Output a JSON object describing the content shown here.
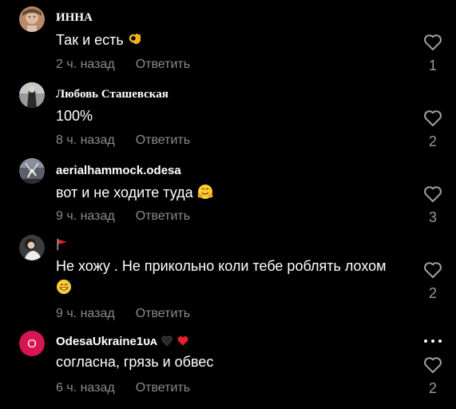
{
  "reply_label": "Ответить",
  "comments": [
    {
      "author": "ИННА",
      "text": "Так и есть",
      "emoji": "ok-hand",
      "time": "2 ч. назад",
      "likes": "1"
    },
    {
      "author": "Любовь Сташевская",
      "text": "100%",
      "time": "8 ч. назад",
      "likes": "2"
    },
    {
      "author": "aerialhammock.odesa",
      "text": "вот и не ходите туда",
      "emoji": "hugging-face",
      "time": "9 ч. назад",
      "likes": "3"
    },
    {
      "author_emoji": "red-flag",
      "text": "Не хожу . Не прикольно коли тебе роблять лохом",
      "emoji": "grinning-sweat",
      "time": "9 ч. назад",
      "likes": "2"
    },
    {
      "author": "OdesaUkraine1ᴜᴀ",
      "author_emojis": [
        "black-heart",
        "red-heart"
      ],
      "avatar_letter": "O",
      "text": "согласна, грязь и обвес",
      "time": "6 ч. назад",
      "likes": "2"
    }
  ],
  "colors": {
    "background": "#000000",
    "secondary_text": "#8a8a8a",
    "avatar_accent": "#d6164f"
  }
}
